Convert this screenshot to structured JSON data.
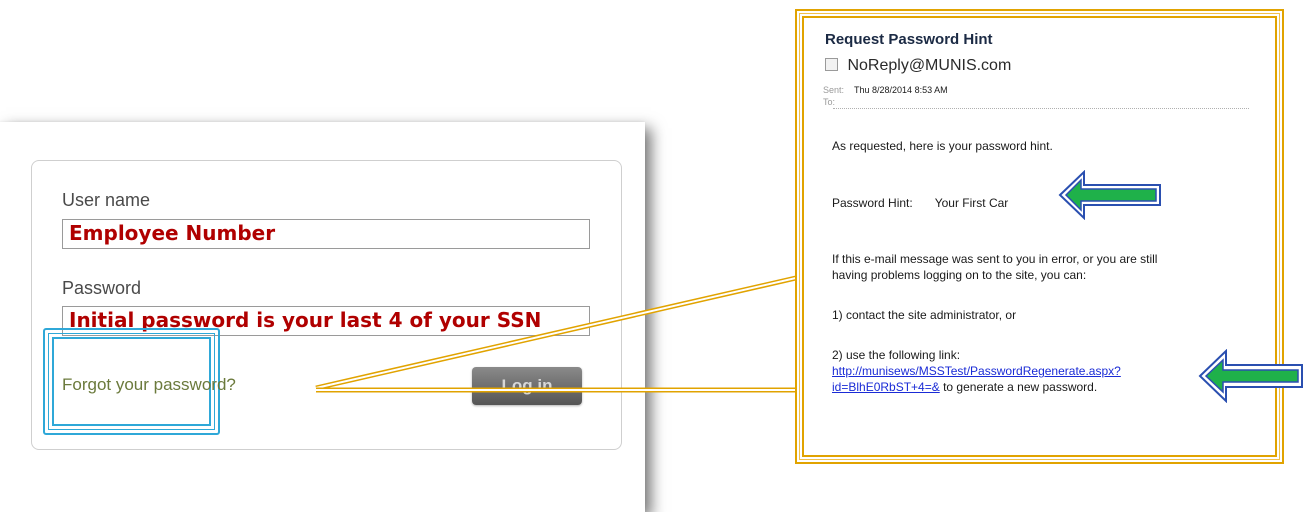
{
  "login": {
    "username_label": "User name",
    "username_value": "Employee Number",
    "password_label": "Password",
    "password_value": "Initial password is your last 4 of your SSN",
    "forgot_link": "Forgot your password?",
    "login_button": "Log in"
  },
  "email": {
    "subject": "Request Password Hint",
    "sender": "NoReply@MUNIS.com",
    "sent_label": "Sent:",
    "sent_value": "Thu 8/28/2014 8:53 AM",
    "to_label": "To:",
    "intro": "As requested, here is your password hint.",
    "hint_label": "Password Hint:",
    "hint_value": "Your First Car",
    "error_line1": "If this e-mail message was sent to you in error, or you are still",
    "error_line2": "having problems logging on to the site, you can:",
    "option1": "1) contact the site administrator, or",
    "option2": "2) use the following link:",
    "link_line1": "http://munisews/MSSTest/PasswordRegenerate.aspx?",
    "link_line2": "id=BlhE0RbST+4=&",
    "link_suffix": " to generate a new password."
  },
  "annotations": {
    "frame_color_login": "#2fa8d8",
    "frame_color_email": "#e1a300",
    "arrow_fill": "#1fb14a",
    "arrow_border": "#2a4fb0",
    "value_text_color": "#b00000"
  }
}
